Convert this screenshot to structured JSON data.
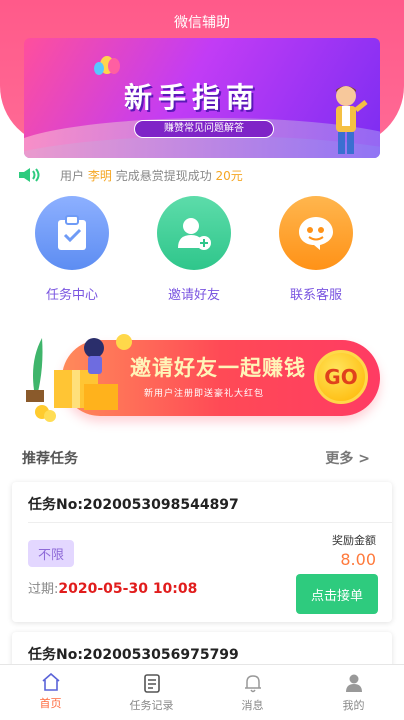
{
  "header": {
    "title": "微信辅助"
  },
  "banner": {
    "title": "新手指南",
    "subtitle": "赚赞常见问题解答"
  },
  "notice": {
    "prefix": "用户",
    "user": "李明",
    "middle": "完成悬赏提现成功",
    "amount": "20元"
  },
  "quick_links": [
    {
      "label": "任务中心",
      "icon": "clipboard-check-icon",
      "color": "#6f9bf6"
    },
    {
      "label": "邀请好友",
      "icon": "add-user-icon",
      "color": "#3dcf95"
    },
    {
      "label": "联系客服",
      "icon": "chat-icon",
      "color": "#ffa12b"
    }
  ],
  "invite_banner": {
    "title": "邀请好友一起赚钱",
    "subtitle": "新用户注册即送豪礼大红包",
    "go": "GO"
  },
  "section": {
    "title": "推荐任务",
    "more": "更多 >"
  },
  "tasks": [
    {
      "no": "任务No:2020053098544897",
      "tag": "不限",
      "reward_label": "奖励金额",
      "reward": "8.00",
      "deadline_label": "过期:",
      "deadline": "2020-05-30 10:08",
      "action": "点击接单"
    },
    {
      "no": "任务No:2020053056975799"
    }
  ],
  "tabbar": [
    {
      "label": "首页",
      "icon": "home-icon",
      "active": true
    },
    {
      "label": "任务记录",
      "icon": "document-icon",
      "active": false
    },
    {
      "label": "消息",
      "icon": "bell-icon",
      "active": false
    },
    {
      "label": "我的",
      "icon": "user-icon",
      "active": false
    }
  ]
}
